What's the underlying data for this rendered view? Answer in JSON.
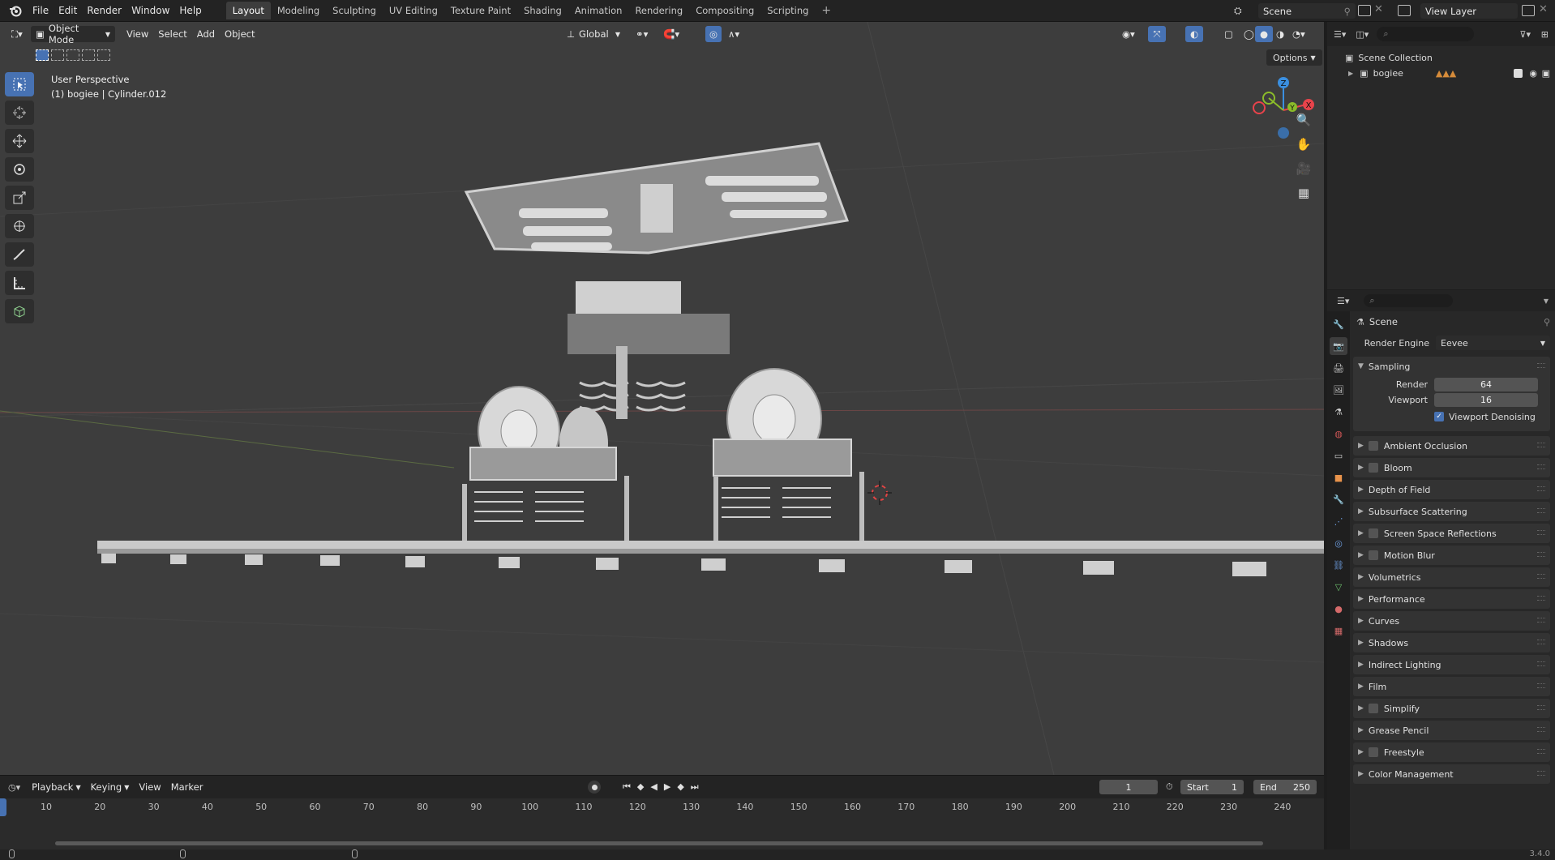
{
  "app": {
    "name": "Blender",
    "version": "3.4.0"
  },
  "menu": [
    "File",
    "Edit",
    "Render",
    "Window",
    "Help"
  ],
  "workspaces": [
    "Layout",
    "Modeling",
    "Sculpting",
    "UV Editing",
    "Texture Paint",
    "Shading",
    "Animation",
    "Rendering",
    "Compositing",
    "Scripting"
  ],
  "active_workspace": "Layout",
  "scene_name": "Scene",
  "view_layer": "View Layer",
  "viewport": {
    "mode": "Object Mode",
    "menus": [
      "View",
      "Select",
      "Add",
      "Object"
    ],
    "transform_orientation": "Global",
    "options_label": "Options",
    "overlay_line1": "User Perspective",
    "overlay_line2": "(1) bogiee | Cylinder.012",
    "gizmo_axes": [
      "Z",
      "Y",
      "X"
    ]
  },
  "timeline": {
    "menus": [
      "Playback",
      "Keying",
      "View",
      "Marker"
    ],
    "current_frame": "1",
    "start_label": "Start",
    "start": "1",
    "end_label": "End",
    "end": "250",
    "ruler": [
      "10",
      "20",
      "30",
      "40",
      "50",
      "60",
      "70",
      "80",
      "90",
      "100",
      "110",
      "120",
      "130",
      "140",
      "150",
      "160",
      "170",
      "180",
      "190",
      "200",
      "210",
      "220",
      "230",
      "240"
    ]
  },
  "outliner": {
    "root": "Scene Collection",
    "items": [
      {
        "name": "bogiee"
      }
    ]
  },
  "properties": {
    "title": "Scene",
    "render_engine_label": "Render Engine",
    "render_engine": "Eevee",
    "sampling": {
      "label": "Sampling",
      "render_label": "Render",
      "render": "64",
      "viewport_label": "Viewport",
      "viewport": "16",
      "denoise_label": "Viewport Denoising"
    },
    "panels": [
      {
        "label": "Ambient Occlusion",
        "checkbox": true
      },
      {
        "label": "Bloom",
        "checkbox": true
      },
      {
        "label": "Depth of Field",
        "checkbox": false
      },
      {
        "label": "Subsurface Scattering",
        "checkbox": false
      },
      {
        "label": "Screen Space Reflections",
        "checkbox": true
      },
      {
        "label": "Motion Blur",
        "checkbox": true
      },
      {
        "label": "Volumetrics",
        "checkbox": false
      },
      {
        "label": "Performance",
        "checkbox": false
      },
      {
        "label": "Curves",
        "checkbox": false
      },
      {
        "label": "Shadows",
        "checkbox": false
      },
      {
        "label": "Indirect Lighting",
        "checkbox": false
      },
      {
        "label": "Film",
        "checkbox": false
      },
      {
        "label": "Simplify",
        "checkbox": true
      },
      {
        "label": "Grease Pencil",
        "checkbox": false
      },
      {
        "label": "Freestyle",
        "checkbox": true
      },
      {
        "label": "Color Management",
        "checkbox": false
      }
    ]
  },
  "colors": {
    "accent": "#4772b3",
    "x_axis": "#e8434b",
    "y_axis": "#8bbc2a",
    "z_axis": "#3a8fe0"
  }
}
